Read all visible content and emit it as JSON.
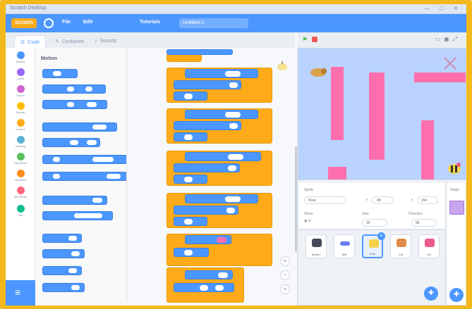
{
  "window": {
    "title": "Scratch Desktop",
    "controls": "— ▢ ✕"
  },
  "menubar": {
    "logo": "Scratch",
    "items": [
      "File",
      "Edit",
      "Tutorials"
    ],
    "project_title": "Untitled-1"
  },
  "tabs": [
    {
      "label": "Code",
      "icon": "code-icon"
    },
    {
      "label": "Costumes",
      "icon": "costume-icon"
    },
    {
      "label": "Sounds",
      "icon": "sound-icon"
    }
  ],
  "categories": [
    {
      "label": "Motion",
      "color": "#4c97ff"
    },
    {
      "label": "Looks",
      "color": "#9966ff"
    },
    {
      "label": "Sound",
      "color": "#cf63cf"
    },
    {
      "label": "Events",
      "color": "#ffbf00"
    },
    {
      "label": "Control",
      "color": "#ffab19"
    },
    {
      "label": "Sensing",
      "color": "#5cb1d6"
    },
    {
      "label": "Operators",
      "color": "#59c059"
    },
    {
      "label": "Variables",
      "color": "#ff8c1a"
    },
    {
      "label": "My Blocks",
      "color": "#ff6680"
    },
    {
      "label": "Pen",
      "color": "#0fbd8c"
    }
  ],
  "palette": {
    "heading": "Motion"
  },
  "sprite_info": {
    "sprite_label": "Sprite",
    "sprite_name": "Pear",
    "x_label": "x",
    "x_value": "-95",
    "y_label": "y",
    "y_value": "154",
    "show_label": "Show",
    "size_label": "Size",
    "size_value": "30",
    "direction_label": "Direction",
    "direction_value": "90"
  },
  "sprites": [
    {
      "name": "Sprite1",
      "color": "#444a57"
    },
    {
      "name": "Ball",
      "color": "#6b7cf0"
    },
    {
      "name": "Pear",
      "color": "#f5d24a",
      "selected": true
    },
    {
      "name": "Cat",
      "color": "#e08a4b"
    },
    {
      "name": "Car",
      "color": "#ec5a8d"
    }
  ],
  "stage_panel": {
    "label": "Stage"
  },
  "colors": {
    "accent": "#4c97ff",
    "events": "#ffab19",
    "stage_bg": "#b9d2ff",
    "walls": "#ff6fae",
    "frame": "#f2b81c"
  }
}
